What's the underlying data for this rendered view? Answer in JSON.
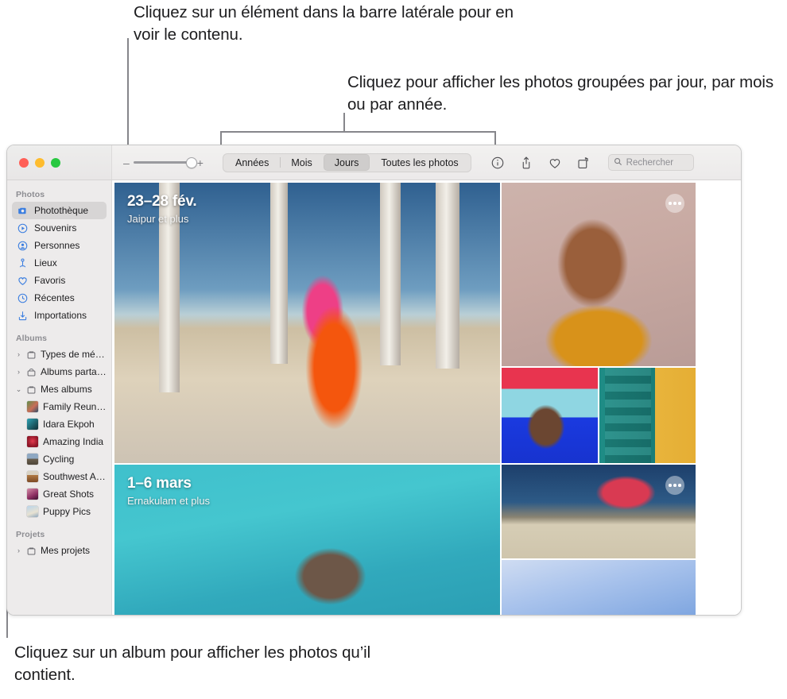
{
  "callouts": {
    "sidebar": "Cliquez sur un élément dans la barre latérale pour en voir le contenu.",
    "tabs": "Cliquez pour afficher les photos groupées par jour, par mois ou par année.",
    "album": "Cliquez sur un album pour afficher les photos qu’il contient."
  },
  "window": {
    "toolbar": {
      "traffic_lights": [
        "close-button",
        "minimize-button",
        "zoom-button"
      ],
      "zoom_minus": "–",
      "zoom_plus": "+",
      "segments": [
        {
          "label": "Années",
          "selected": false
        },
        {
          "label": "Mois",
          "selected": false
        },
        {
          "label": "Jours",
          "selected": true
        },
        {
          "label": "Toutes les photos",
          "selected": false
        }
      ],
      "icons": [
        "info-icon",
        "share-icon",
        "heart-icon",
        "rotate-icon"
      ],
      "search": {
        "placeholder": "Rechercher",
        "value": ""
      }
    },
    "sidebar": {
      "sections": [
        {
          "title": "Photos",
          "items": [
            {
              "label": "Photothèque",
              "icon": "photo-library-icon",
              "selected": true
            },
            {
              "label": "Souvenirs",
              "icon": "memories-icon",
              "selected": false
            },
            {
              "label": "Personnes",
              "icon": "people-icon",
              "selected": false
            },
            {
              "label": "Lieux",
              "icon": "places-pin-icon",
              "selected": false
            },
            {
              "label": "Favoris",
              "icon": "heart-icon",
              "selected": false
            },
            {
              "label": "Récentes",
              "icon": "clock-icon",
              "selected": false
            },
            {
              "label": "Importations",
              "icon": "import-icon",
              "selected": false
            }
          ]
        },
        {
          "title": "Albums",
          "items": [
            {
              "label": "Types de média",
              "icon": "folder-icon",
              "disclosure": "collapsed"
            },
            {
              "label": "Albums partagés",
              "icon": "shared-folder-icon",
              "disclosure": "collapsed"
            },
            {
              "label": "Mes albums",
              "icon": "folder-icon",
              "disclosure": "expanded"
            }
          ],
          "albums": [
            {
              "label": "Family Reuni…",
              "thumb": "#b96a5d"
            },
            {
              "label": "Idara Ekpoh",
              "thumb": "#2e7f92"
            },
            {
              "label": "Amazing India",
              "thumb": "#b2243a"
            },
            {
              "label": "Cycling",
              "thumb": "#7d8e9c"
            },
            {
              "label": "Southwest A…",
              "thumb": "#9a6a45"
            },
            {
              "label": "Great Shots",
              "thumb": "#8e3f63"
            },
            {
              "label": "Puppy Pics",
              "thumb": "#8fb4d6"
            }
          ]
        },
        {
          "title": "Projets",
          "items": [
            {
              "label": "Mes projets",
              "icon": "folder-icon",
              "disclosure": "collapsed"
            }
          ]
        }
      ]
    },
    "groups": [
      {
        "date": "23–28 fév.",
        "place": "Jaipur et plus",
        "photos": [
          "dancer-in-pavilion",
          "smiling-woman-portrait",
          "man-with-sunglasses",
          "woman-by-green-door"
        ]
      },
      {
        "date": "1–6 mars",
        "place": "Ernakulam et plus",
        "photos": [
          "woman-swimming",
          "cyclist-with-red-cape",
          "person-against-sky"
        ]
      }
    ]
  },
  "colors": {
    "accent": "#3b7ee0",
    "selection": "#d7d5d5",
    "sidebar_bg": "#edebeb",
    "leader": "#86868b"
  }
}
